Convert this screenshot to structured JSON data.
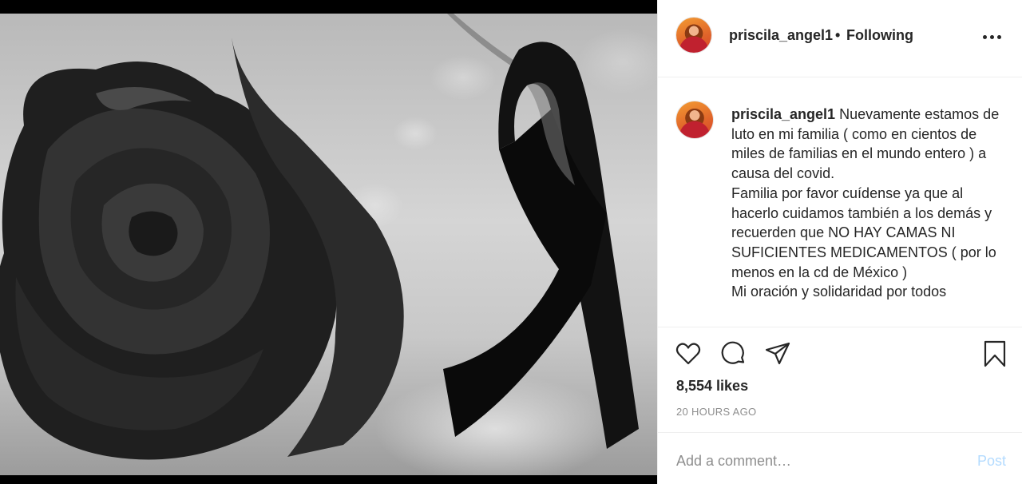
{
  "post": {
    "username": "priscila_angel1",
    "separator": "•",
    "follow_status": "Following",
    "caption": "Nuevamente estamos de luto en mi familia ( como en cientos de miles de familias en el mundo entero ) a causa del covid.\nFamilia por favor cuídense ya que al hacerlo cuidamos también a los demás y recuerden que NO HAY CAMAS NI SUFICIENTES MEDICAMENTOS ( por lo menos en la cd de México )\nMi oración y solidaridad por todos",
    "likes": "8,554 likes",
    "timestamp": "20 HOURS AGO"
  },
  "comment_box": {
    "placeholder": "Add a comment…",
    "post_label": "Post"
  },
  "icons": {
    "more": "more-options-icon",
    "like": "heart-icon",
    "comment": "comment-bubble-icon",
    "share": "paper-plane-icon",
    "save": "bookmark-icon"
  },
  "colors": {
    "text": "#262626",
    "muted": "#8e8e8e",
    "post_disabled": "#b3dbff",
    "divider": "#efefef"
  }
}
